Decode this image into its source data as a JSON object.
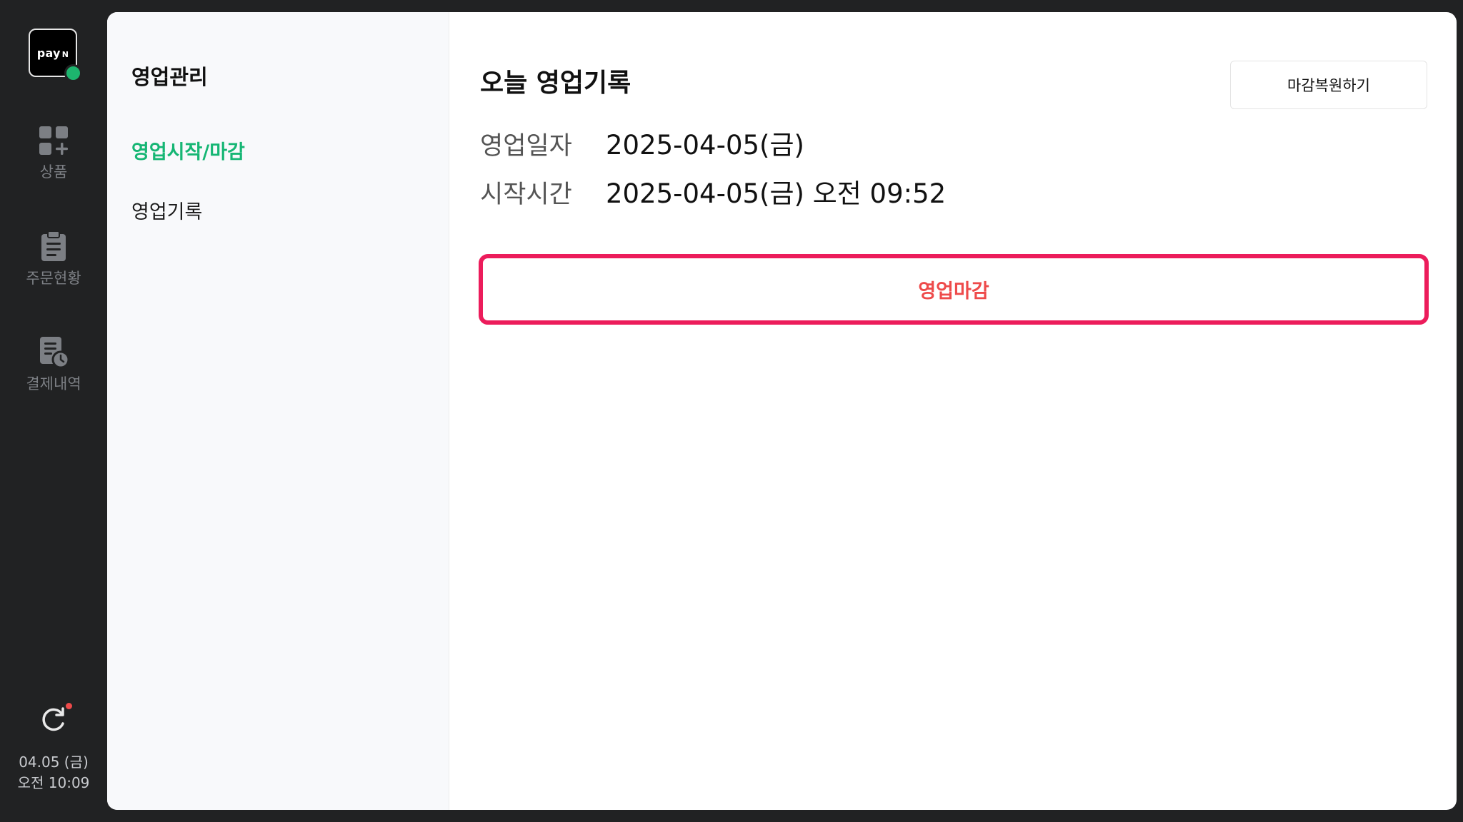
{
  "rail": {
    "logo_text": "pay",
    "logo_mark": "N",
    "status_color": "#1db56e",
    "items": [
      {
        "label": "상품",
        "icon": "grid-plus-icon"
      },
      {
        "label": "주문현황",
        "icon": "clipboard-icon"
      },
      {
        "label": "결제내역",
        "icon": "receipt-clock-icon"
      }
    ],
    "refresh_icon": "refresh-icon",
    "date": "04.05 (금)",
    "time": "오전 10:09"
  },
  "subnav": {
    "title": "영업관리",
    "items": [
      {
        "label": "영업시작/마감",
        "active": true
      },
      {
        "label": "영업기록",
        "active": false
      }
    ]
  },
  "main": {
    "title": "오늘 영업기록",
    "restore_button": "마감복원하기",
    "info": [
      {
        "label": "영업일자",
        "value": "2025-04-05(금)"
      },
      {
        "label": "시작시간",
        "value": "2025-04-05(금) 오전 09:52"
      }
    ],
    "close_button": "영업마감"
  },
  "colors": {
    "accent_green": "#16b674",
    "danger": "#ec1c5b",
    "danger_text": "#ee4a4a",
    "rail_bg": "#212223"
  }
}
